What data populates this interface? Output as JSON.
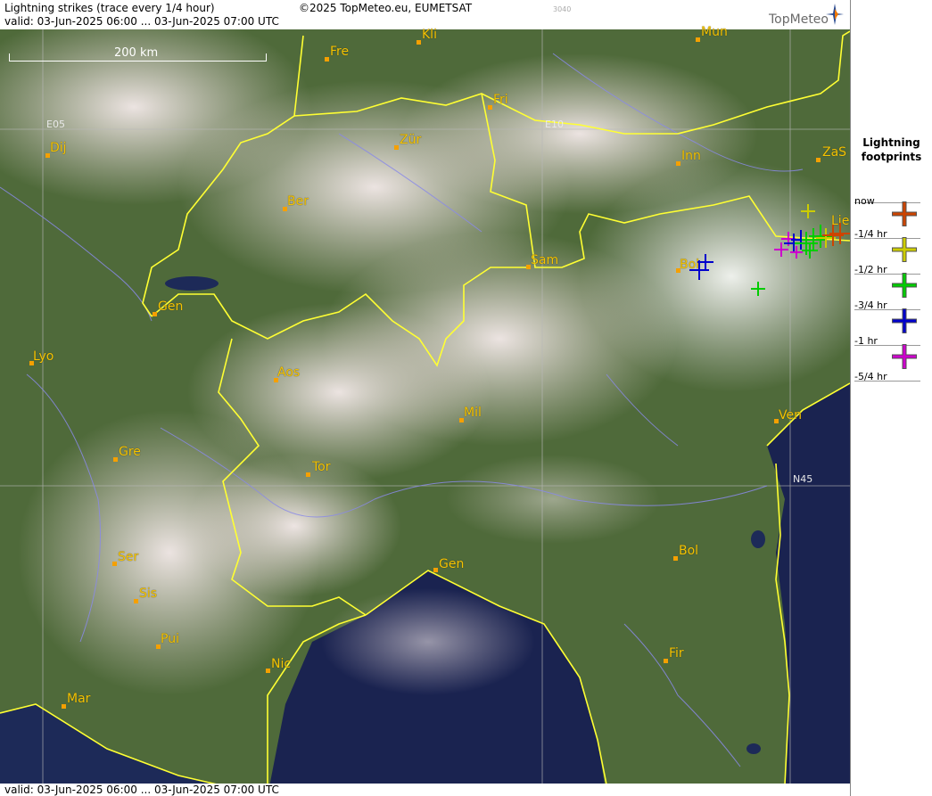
{
  "header": {
    "title": "Lightning strikes (trace every 1/4 hour)",
    "copyright": "©2025 TopMeteo.eu, EUMETSAT",
    "code": "3040",
    "brand": "TopMeteo",
    "valid_top": "valid:  03-Jun-2025 06:00 ... 03-Jun-2025 07:00 UTC",
    "valid_bottom": "valid:  03-Jun-2025 06:00 ... 03-Jun-2025 07:00 UTC"
  },
  "scale": {
    "label": "200 km"
  },
  "grid_labels": {
    "e05": "E05",
    "e10": "E10",
    "n45": "N45"
  },
  "cities": [
    {
      "name": "Kli"
    },
    {
      "name": "Mun"
    },
    {
      "name": "Fre"
    },
    {
      "name": "Fri"
    },
    {
      "name": "Dij"
    },
    {
      "name": "Zür"
    },
    {
      "name": "Inn"
    },
    {
      "name": "ZaS"
    },
    {
      "name": "Ber"
    },
    {
      "name": "Lie"
    },
    {
      "name": "Sam"
    },
    {
      "name": "Bol"
    },
    {
      "name": "Gen"
    },
    {
      "name": "Lyo"
    },
    {
      "name": "Aos"
    },
    {
      "name": "Mil"
    },
    {
      "name": "Ven"
    },
    {
      "name": "Gre"
    },
    {
      "name": "Tor"
    },
    {
      "name": "Ser"
    },
    {
      "name": "Bol"
    },
    {
      "name": "Gen"
    },
    {
      "name": "Sis"
    },
    {
      "name": "Pui"
    },
    {
      "name": "Nic"
    },
    {
      "name": "Fir"
    },
    {
      "name": "Mar"
    }
  ],
  "legend": {
    "title": "Lightning footprints",
    "items": [
      {
        "label": "now",
        "color": "#cc4400"
      },
      {
        "label": "-1/4 hr",
        "color": "#cccc00"
      },
      {
        "label": "-1/2 hr",
        "color": "#00cc00"
      },
      {
        "label": "-3/4 hr",
        "color": "#0000cc"
      },
      {
        "label": "-1 hr",
        "color": "#cc00cc"
      },
      {
        "label": "-5/4 hr",
        "color": "#999999"
      }
    ]
  },
  "colors": {
    "border": "#ffff33",
    "river": "#8a8ae8",
    "city": "#f5c400"
  }
}
